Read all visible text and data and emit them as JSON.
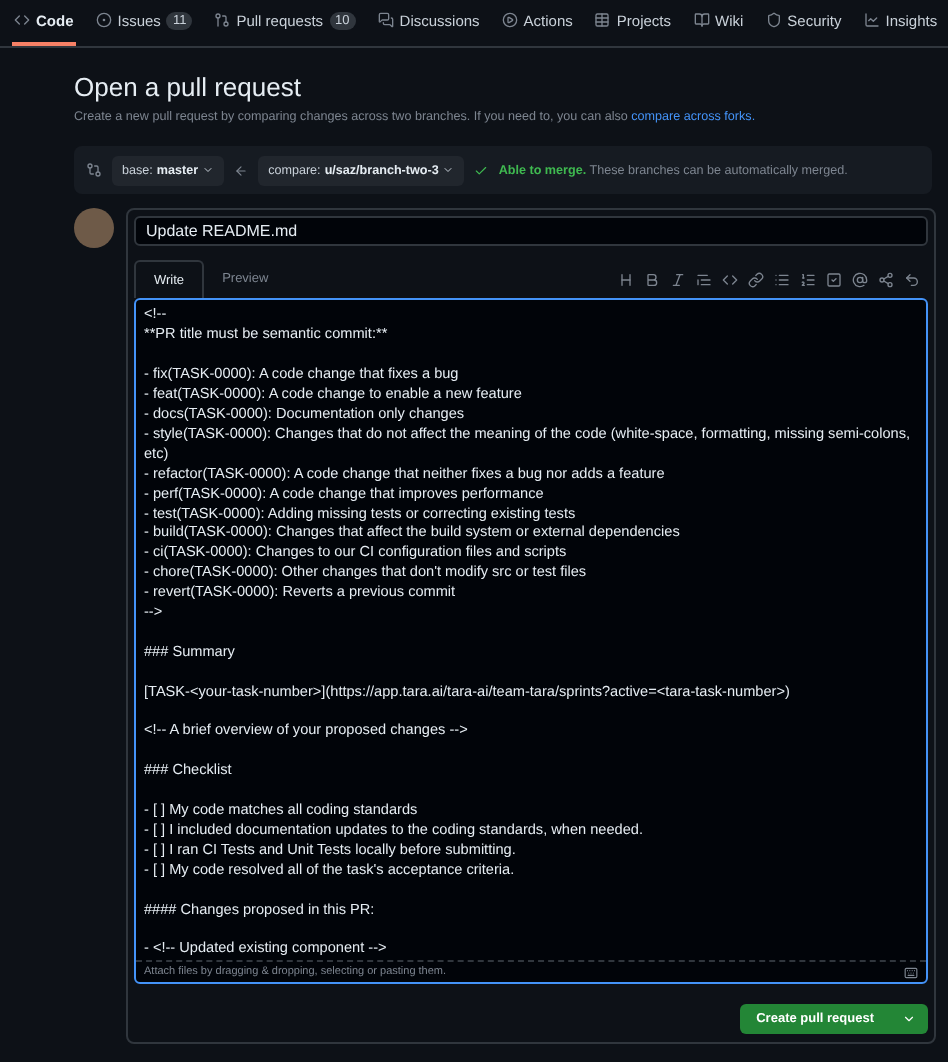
{
  "nav": [
    {
      "kind": "code",
      "label": "Code",
      "selected": true
    },
    {
      "kind": "issues",
      "label": "Issues",
      "count": "11",
      "selected": false
    },
    {
      "kind": "pulls",
      "label": "Pull requests",
      "count": "10",
      "selected": false
    },
    {
      "kind": "discussions",
      "label": "Discussions",
      "selected": false
    },
    {
      "kind": "actions",
      "label": "Actions",
      "selected": false
    },
    {
      "kind": "projects",
      "label": "Projects",
      "selected": false
    },
    {
      "kind": "wiki",
      "label": "Wiki",
      "selected": false
    },
    {
      "kind": "security",
      "label": "Security",
      "selected": false
    },
    {
      "kind": "insights",
      "label": "Insights",
      "selected": false
    }
  ],
  "heading": "Open a pull request",
  "subtitle": "Create a new pull request by comparing changes across two branches. If you need to, you can also ",
  "subtitle_link": "compare across forks.",
  "base": {
    "prefix": "base: ",
    "branch": "master"
  },
  "compare": {
    "prefix": "compare: ",
    "branch": "u/saz/branch-two-3"
  },
  "merge_status": {
    "ok": "Able to merge.",
    "text": " These branches can be automatically merged."
  },
  "title_value": "Update README.md",
  "editor_tabs": [
    {
      "label": "Write",
      "selected": true
    },
    {
      "label": "Preview",
      "selected": false
    }
  ],
  "toolbar": [
    {
      "kind": "heading"
    },
    {
      "kind": "bold"
    },
    {
      "kind": "italic"
    },
    {
      "kind": "quote"
    },
    {
      "kind": "code"
    },
    {
      "kind": "link"
    },
    {
      "kind": "bullets"
    },
    {
      "kind": "numbers"
    },
    {
      "kind": "tasks"
    },
    {
      "kind": "mention"
    },
    {
      "kind": "reference"
    },
    {
      "kind": "undo"
    }
  ],
  "body": "<!--\n**PR title must be semantic commit:**\n\n- fix(TASK-0000): A code change that fixes a bug\n- feat(TASK-0000): A code change to enable a new feature\n- docs(TASK-0000): Documentation only changes\n- style(TASK-0000): Changes that do not affect the meaning of the code (white-space, formatting, missing semi-colons, etc)\n- refactor(TASK-0000): A code change that neither fixes a bug nor adds a feature\n- perf(TASK-0000): A code change that improves performance\n- test(TASK-0000): Adding missing tests or correcting existing tests\n- build(TASK-0000): Changes that affect the build system or external dependencies\n- ci(TASK-0000): Changes to our CI configuration files and scripts\n- chore(TASK-0000): Other changes that don't modify src or test files\n- revert(TASK-0000): Reverts a previous commit\n-->\n\n### Summary\n\n[TASK-<your-task-number>](https://app.tara.ai/tara-ai/team-tara/sprints?active=<tara-task-number>)\n\n<!-- A brief overview of your proposed changes -->\n\n### Checklist\n\n- [ ] My code matches all coding standards\n- [ ] I included documentation updates to the coding standards, when needed.\n- [ ] I ran CI Tests and Unit Tests locally before submitting.\n- [ ] My code resolved all of the task's acceptance criteria.\n\n#### Changes proposed in this PR:\n\n- <!-- Updated existing component -->",
  "attach_hint": "Attach files by dragging & dropping, selecting or pasting them.",
  "submit": "Create pull request"
}
